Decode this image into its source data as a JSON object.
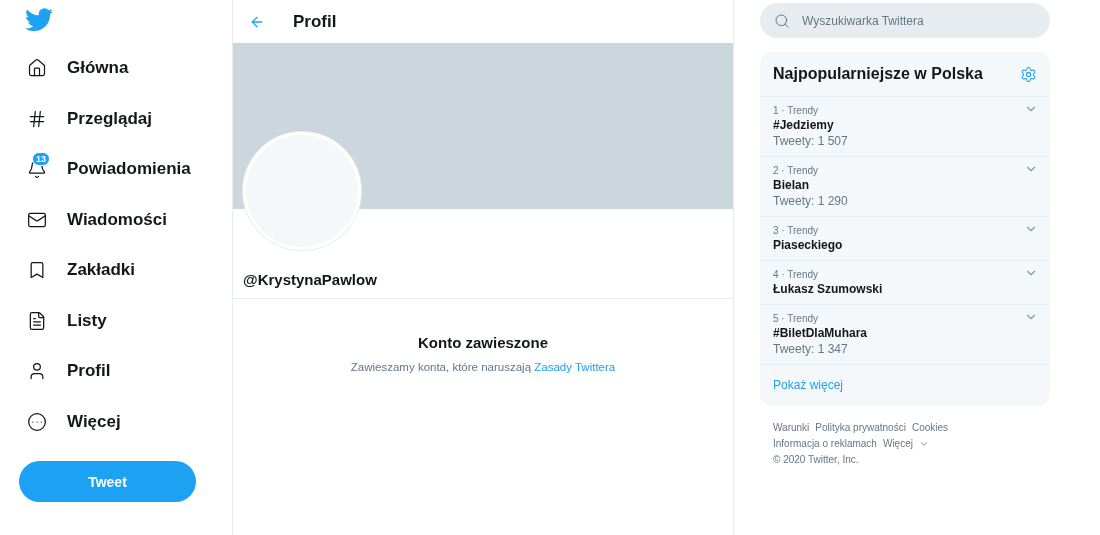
{
  "nav": {
    "items": [
      {
        "kind": "home",
        "label": "Główna"
      },
      {
        "kind": "hash",
        "label": "Przeglądaj"
      },
      {
        "kind": "bell",
        "label": "Powiadomienia",
        "badge": "13"
      },
      {
        "kind": "mail",
        "label": "Wiadomości"
      },
      {
        "kind": "bookmark",
        "label": "Zakładki"
      },
      {
        "kind": "list",
        "label": "Listy"
      },
      {
        "kind": "user",
        "label": "Profil"
      },
      {
        "kind": "more",
        "label": "Więcej"
      }
    ],
    "tweet_button": "Tweet"
  },
  "header": {
    "title": "Profil"
  },
  "profile": {
    "handle": "@KrystynaPawlow",
    "notice_title": "Konto zawieszone",
    "notice_text": "Zawieszamy konta, które naruszają ",
    "notice_link": "Zasady Twittera"
  },
  "search": {
    "placeholder": "Wyszukiwarka Twittera"
  },
  "trends": {
    "title": "Najpopularniejsze w Polska",
    "items": [
      {
        "meta": "1 · Trendy",
        "name": "#Jedziemy",
        "count": "Tweety: 1 507"
      },
      {
        "meta": "2 · Trendy",
        "name": "Bielan",
        "count": "Tweety: 1 290"
      },
      {
        "meta": "3 · Trendy",
        "name": "Piaseckiego"
      },
      {
        "meta": "4 · Trendy",
        "name": "Łukasz Szumowski"
      },
      {
        "meta": "5 · Trendy",
        "name": "#BiletDlaMuhara",
        "count": "Tweety: 1 347"
      }
    ],
    "show_more": "Pokaż więcej"
  },
  "footer": {
    "links": [
      [
        "Warunki",
        "Polityka prywatności",
        "Cookies"
      ],
      [
        "Informacja o reklamach",
        "Więcej"
      ]
    ],
    "copyright": "© 2020 Twitter, Inc."
  }
}
